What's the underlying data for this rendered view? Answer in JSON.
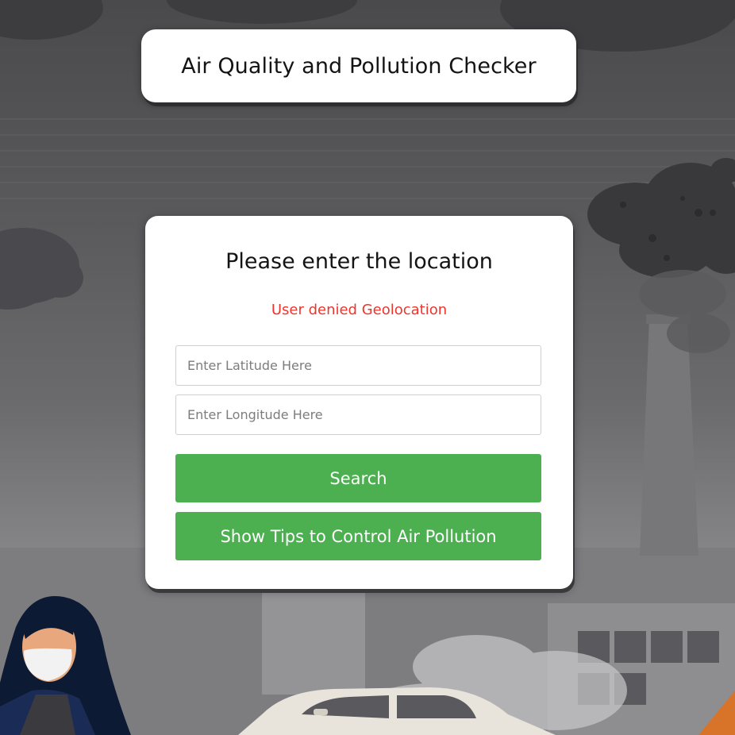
{
  "header": {
    "title": "Air Quality and Pollution Checker"
  },
  "form": {
    "heading": "Please enter the location",
    "error_message": "User denied Geolocation",
    "latitude": {
      "value": "",
      "placeholder": "Enter Latitude Here"
    },
    "longitude": {
      "value": "",
      "placeholder": "Enter Longitude Here"
    },
    "search_label": "Search",
    "tips_label": "Show Tips to Control Air Pollution"
  },
  "colors": {
    "accent_green": "#4caf50",
    "error_red": "#f0342c",
    "card_background": "#ffffff"
  },
  "background": {
    "scene_icons": [
      "smoke-cloud-icon",
      "factory-chimney-icon",
      "woman-with-mask-icon",
      "car-icon"
    ]
  }
}
